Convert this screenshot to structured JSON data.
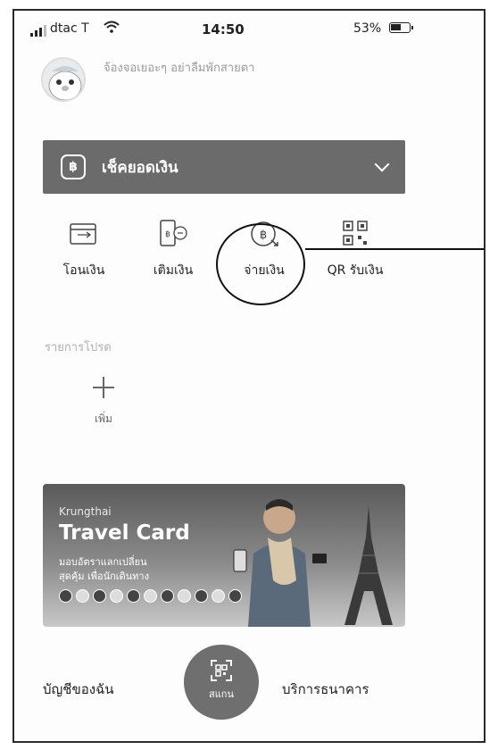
{
  "status_bar": {
    "carrier": "dtac T",
    "time": "14:50",
    "battery": "53%"
  },
  "greeting": "จ้องจอเยอะๆ อย่าลืมพักสายตา",
  "balance_bar": {
    "label": "เช็คยอดเงิน",
    "icon": "baht-icon"
  },
  "actions": [
    {
      "label": "โอนเงิน",
      "icon": "wallet-transfer-icon"
    },
    {
      "label": "เติมเงิน",
      "icon": "topup-phone-icon"
    },
    {
      "label": "จ่ายเงิน",
      "icon": "baht-pay-icon"
    },
    {
      "label": "QR รับเงิน",
      "icon": "qr-code-icon"
    }
  ],
  "favorites": {
    "title": "รายการโปรด",
    "add_label": "เพิ่ม"
  },
  "banner": {
    "brand": "Krungthai",
    "title": "Travel Card",
    "line1": "มอบอัตราแลกเปลี่ยน",
    "line2": "สุดคุ้ม เพื่อนักเดินทาง"
  },
  "bottom_nav": {
    "left": "บัญชีของฉัน",
    "scan": "สแกน",
    "right": "บริการธนาคาร"
  }
}
